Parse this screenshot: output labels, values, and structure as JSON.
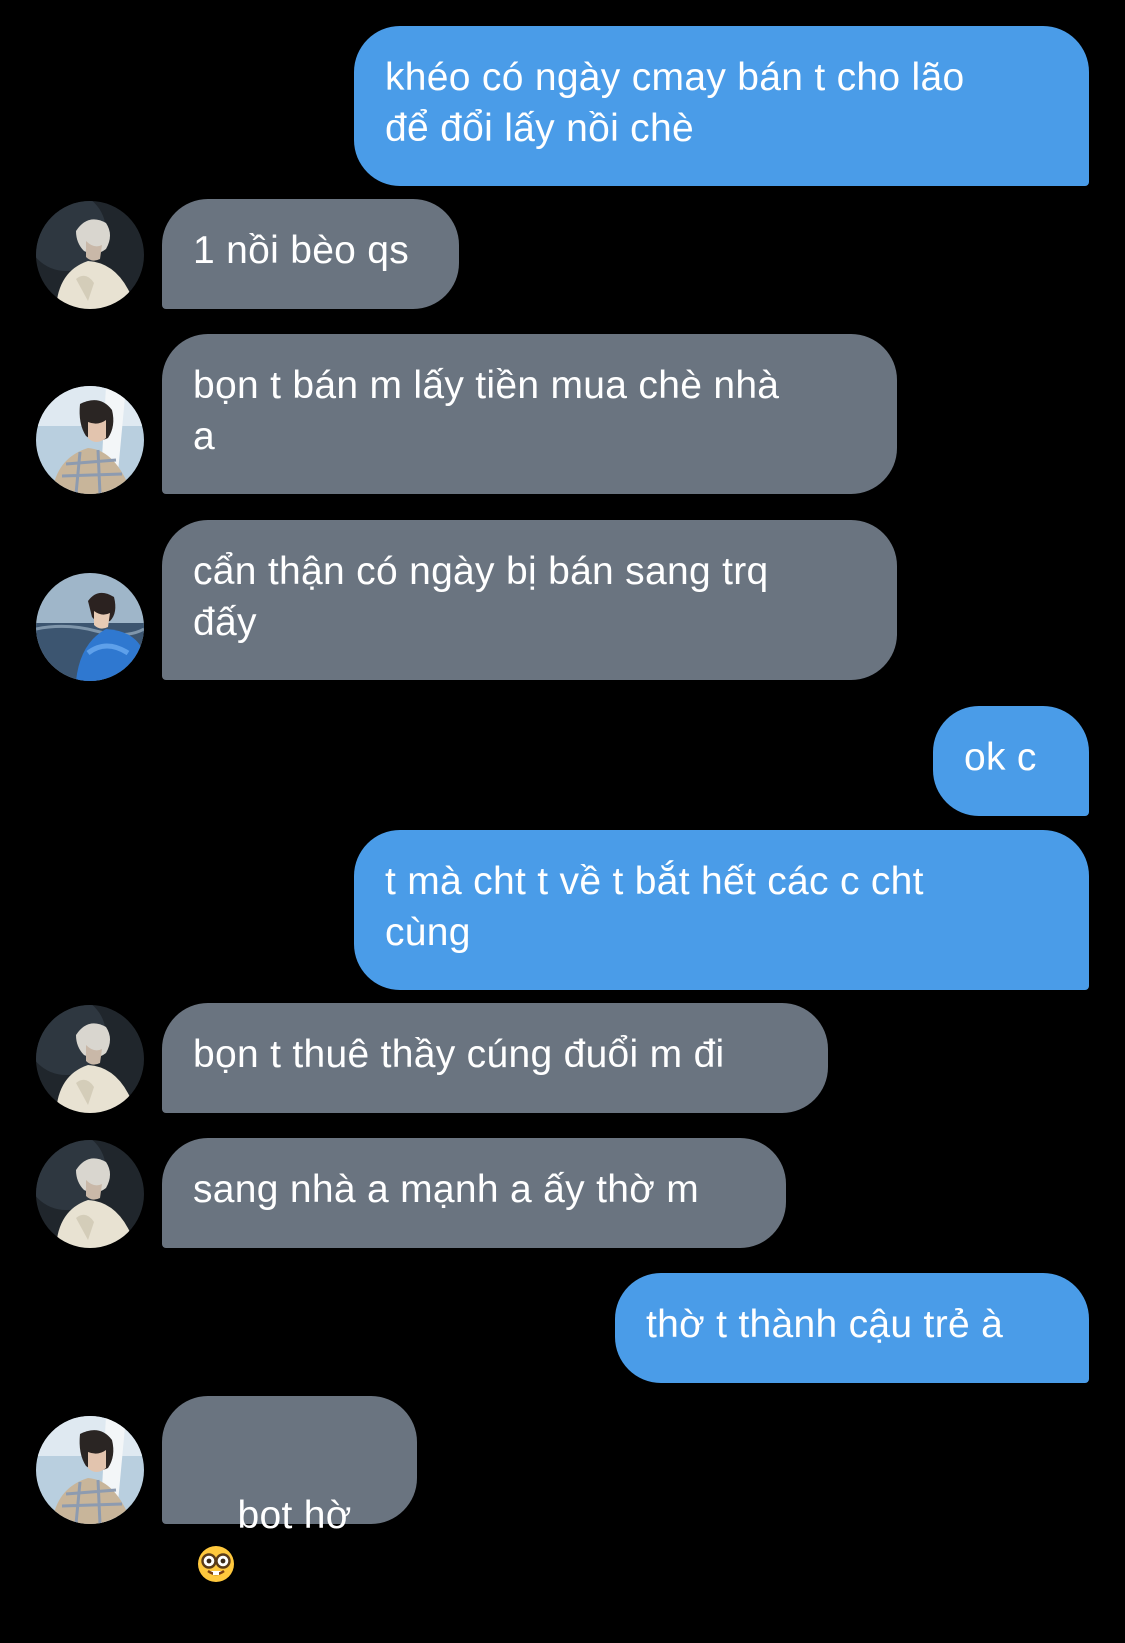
{
  "colors": {
    "background": "#000000",
    "outgoing_bubble": "#4a9ce8",
    "incoming_bubble": "#6a7480",
    "text": "#ffffff"
  },
  "messages": [
    {
      "direction": "outgoing",
      "text": "khéo có ngày cmay bán t cho lão\nđể đổi lấy nồi chè"
    },
    {
      "direction": "incoming",
      "avatar": "avatar-pale-hair-icon",
      "text": "1 nồi bèo qs"
    },
    {
      "direction": "incoming",
      "avatar": "avatar-dark-hair-plaid-icon",
      "text": "bọn t bán m lấy tiền mua chè nhà\na"
    },
    {
      "direction": "incoming",
      "avatar": "avatar-blue-jacket-sea-icon",
      "text": "cẩn thận có ngày bị bán sang trq\nđấy"
    },
    {
      "direction": "outgoing",
      "text": "ok c"
    },
    {
      "direction": "outgoing",
      "text": "t mà cht t về t bắt hết các c cht\ncùng"
    },
    {
      "direction": "incoming",
      "avatar": "avatar-pale-hair-icon",
      "text": "bọn t thuê thầy cúng đuổi m đi"
    },
    {
      "direction": "incoming",
      "avatar": "avatar-pale-hair-icon",
      "text": "sang nhà a mạnh a ấy thờ m"
    },
    {
      "direction": "outgoing",
      "text": "thờ t thành cậu trẻ à"
    },
    {
      "direction": "incoming",
      "avatar": "avatar-dark-hair-plaid-icon",
      "text": "bot hờ",
      "emoji": "nerd-face-emoji-icon"
    }
  ]
}
